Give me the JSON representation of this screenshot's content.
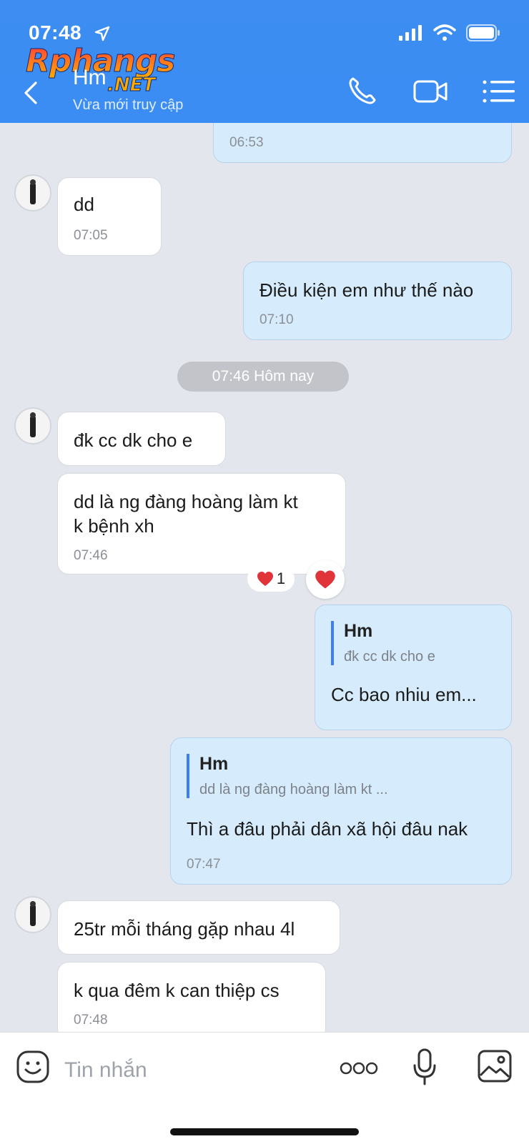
{
  "status": {
    "time": "07:48"
  },
  "header": {
    "logo_main": "Rphangs",
    "logo_sub": ".NET",
    "contact_name": "Hm",
    "contact_status": "Vừa mới truy cập",
    "icons": [
      "back-icon",
      "phone-icon",
      "video-icon",
      "menu-icon"
    ]
  },
  "messages": {
    "m0_time": "06:53",
    "m1": {
      "text": "dd",
      "time": "07:05"
    },
    "m2": {
      "text": "Điều kiện em như thế nào",
      "time": "07:10"
    },
    "divider": "07:46 Hôm nay",
    "m3": {
      "text": "đk cc dk cho e"
    },
    "m4": {
      "line1": "dd là ng đàng hoàng làm kt",
      "line2": "k bệnh xh",
      "time": "07:46",
      "reaction_count": "1"
    },
    "m5": {
      "quote_name": "Hm",
      "quote_text": "đk cc dk cho e",
      "text": "Cc bao nhiu em..."
    },
    "m6": {
      "quote_name": "Hm",
      "quote_text": "dd là ng đàng hoàng làm kt ...",
      "text": "Thì a đâu phải dân xã hội đâu nak",
      "time": "07:47"
    },
    "m7": {
      "text": "25tr mỗi tháng gặp nhau 4l"
    },
    "m8": {
      "text": "k qua đêm k can thiệp cs",
      "time": "07:48"
    }
  },
  "input": {
    "placeholder": "Tin nhắn"
  },
  "colors": {
    "header": "#3b8df3",
    "outgoing": "#d6ecfc",
    "incoming": "#ffffff",
    "background": "#e3e6ec",
    "accent": "#3d7ff0"
  }
}
